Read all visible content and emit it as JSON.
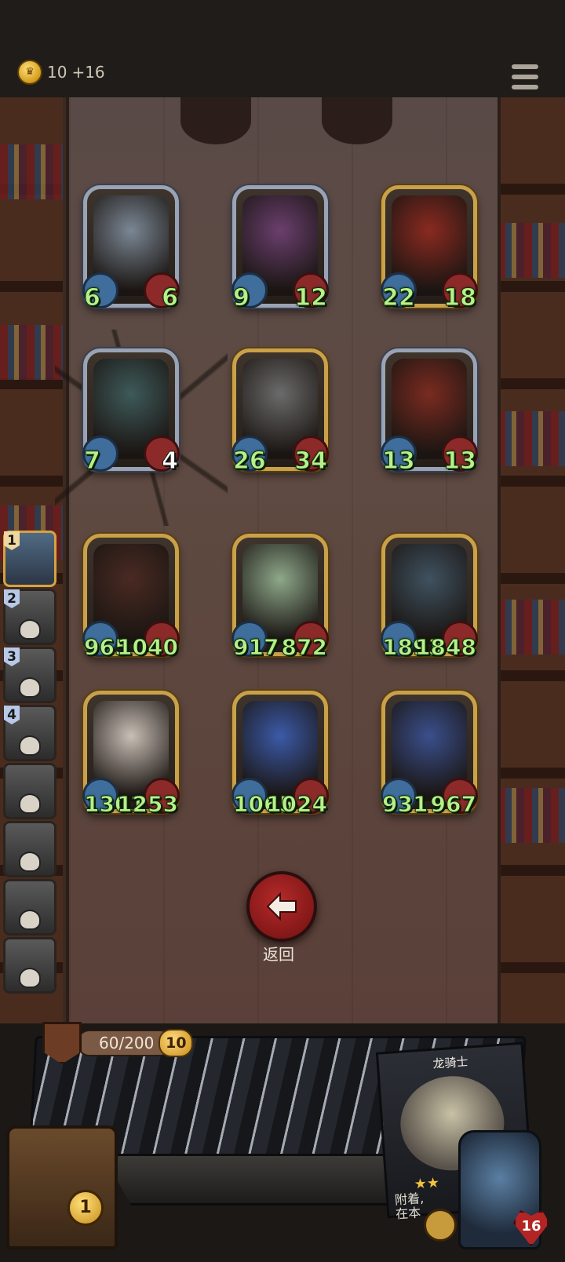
{
  "topbar": {
    "gold": "10",
    "gold_bonus": "+16"
  },
  "board": {
    "rows": [
      [
        {
          "atk": "6",
          "hp": "6",
          "frame": "silver",
          "art": "#7b8794"
        },
        {
          "atk": "9",
          "hp": "12",
          "frame": "silver",
          "art": "#6a3f6e"
        },
        {
          "atk": "22",
          "hp": "18",
          "frame": "gold",
          "art": "#8a2a20"
        }
      ],
      [
        {
          "atk": "7",
          "hp": "4",
          "frame": "silver",
          "art": "#3e5a5a"
        },
        {
          "atk": "26",
          "hp": "34",
          "frame": "gold",
          "art": "#6b6b6b"
        },
        {
          "atk": "13",
          "hp": "13",
          "frame": "silver",
          "art": "#7a2b20"
        }
      ],
      [
        {
          "atk": "965",
          "hp": "1040",
          "frame": "gold",
          "art": "#4a2a22"
        },
        {
          "atk": "917",
          "hp": "872",
          "frame": "gold",
          "art": "#8ea88a"
        },
        {
          "atk": "1893",
          "hp": "1848",
          "frame": "gold",
          "art": "#3f5260"
        }
      ],
      [
        {
          "atk": "1301",
          "hp": "1253",
          "frame": "gold",
          "art": "#c9bfb6"
        },
        {
          "atk": "1065",
          "hp": "1024",
          "frame": "gold",
          "art": "#3b5aa8"
        },
        {
          "atk": "931",
          "hp": "967",
          "frame": "gold",
          "art": "#3a4f8c"
        }
      ]
    ]
  },
  "back_label": "返回",
  "opponents": [
    {
      "num": "1",
      "state": "active"
    },
    {
      "num": "2",
      "state": "dead"
    },
    {
      "num": "3",
      "state": "dead"
    },
    {
      "num": "4",
      "state": "dead"
    },
    {
      "num": "",
      "state": "dead"
    },
    {
      "num": "",
      "state": "dead"
    },
    {
      "num": "",
      "state": "dead"
    },
    {
      "num": "",
      "state": "dead"
    }
  ],
  "bottom": {
    "xp": "60/200",
    "level": "10",
    "preview_name": "龙骑士",
    "preview_text_1": "附着,",
    "preview_text_2": "在本",
    "chest_count": "1",
    "hero_hp": "16"
  },
  "colors": {
    "gold_frame": "#c9a14a",
    "silver_frame": "#9aa3b3",
    "stat_green": "#b6f08a",
    "back_red": "#b52a2a"
  }
}
